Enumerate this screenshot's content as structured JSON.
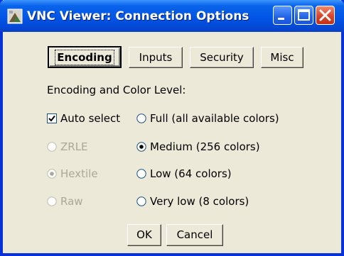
{
  "window": {
    "title": "VNC Viewer: Connection Options",
    "titlebar_color": "#0255e6",
    "body_color": "#ece9d8"
  },
  "tabs": [
    {
      "label": "Encoding",
      "selected": true
    },
    {
      "label": "Inputs",
      "selected": false
    },
    {
      "label": "Security",
      "selected": false
    },
    {
      "label": "Misc",
      "selected": false
    }
  ],
  "section_label": "Encoding and Color Level:",
  "auto_select": {
    "label": "Auto select",
    "checked": true
  },
  "encodings": [
    {
      "label": "ZRLE",
      "selected": false,
      "enabled": false
    },
    {
      "label": "Hextile",
      "selected": true,
      "enabled": false
    },
    {
      "label": "Raw",
      "selected": false,
      "enabled": false
    }
  ],
  "color_levels": [
    {
      "label": "Full (all available colors)",
      "selected": false
    },
    {
      "label": "Medium (256 colors)",
      "selected": true
    },
    {
      "label": "Low (64 colors)",
      "selected": false
    },
    {
      "label": "Very low (8 colors)",
      "selected": false
    }
  ],
  "buttons": {
    "ok": "OK",
    "cancel": "Cancel"
  },
  "icons": {
    "app": "vnc-app-icon",
    "minimize": "minimize-icon",
    "maximize": "maximize-icon",
    "close": "close-icon"
  }
}
